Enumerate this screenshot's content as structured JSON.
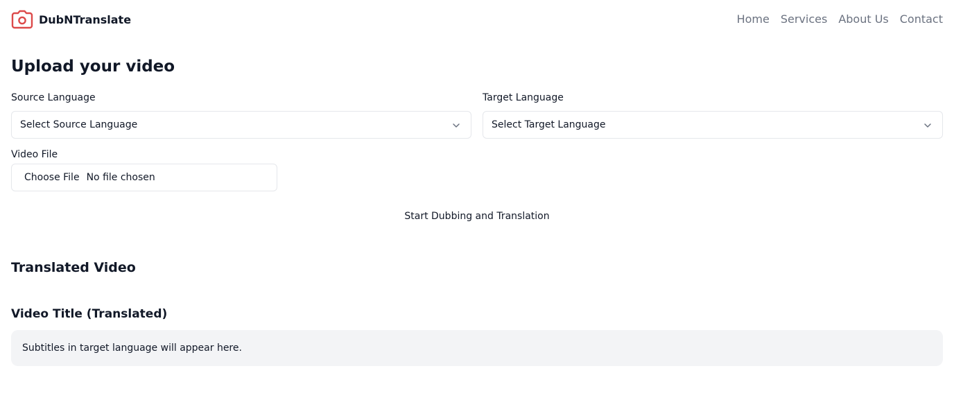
{
  "brand": {
    "name": "DubNTranslate",
    "icon": "camera-icon",
    "icon_color": "#dc4a4a"
  },
  "nav": {
    "items": [
      "Home",
      "Services",
      "About Us",
      "Contact"
    ]
  },
  "upload": {
    "title": "Upload your video",
    "source_label": "Source Language",
    "source_value": "Select Source Language",
    "target_label": "Target Language",
    "target_value": "Select Target Language",
    "file_label": "Video File",
    "file_button": "Choose File",
    "file_status": "No file chosen",
    "submit_label": "Start Dubbing and Translation"
  },
  "result": {
    "section_title": "Translated Video",
    "video_title": "Video Title (Translated)",
    "subtitles_placeholder": "Subtitles in target language will appear here."
  },
  "colors": {
    "text": "#111827",
    "nav_text": "#6b7280",
    "border": "#e5e7eb",
    "panel_bg": "#f3f4f6"
  }
}
